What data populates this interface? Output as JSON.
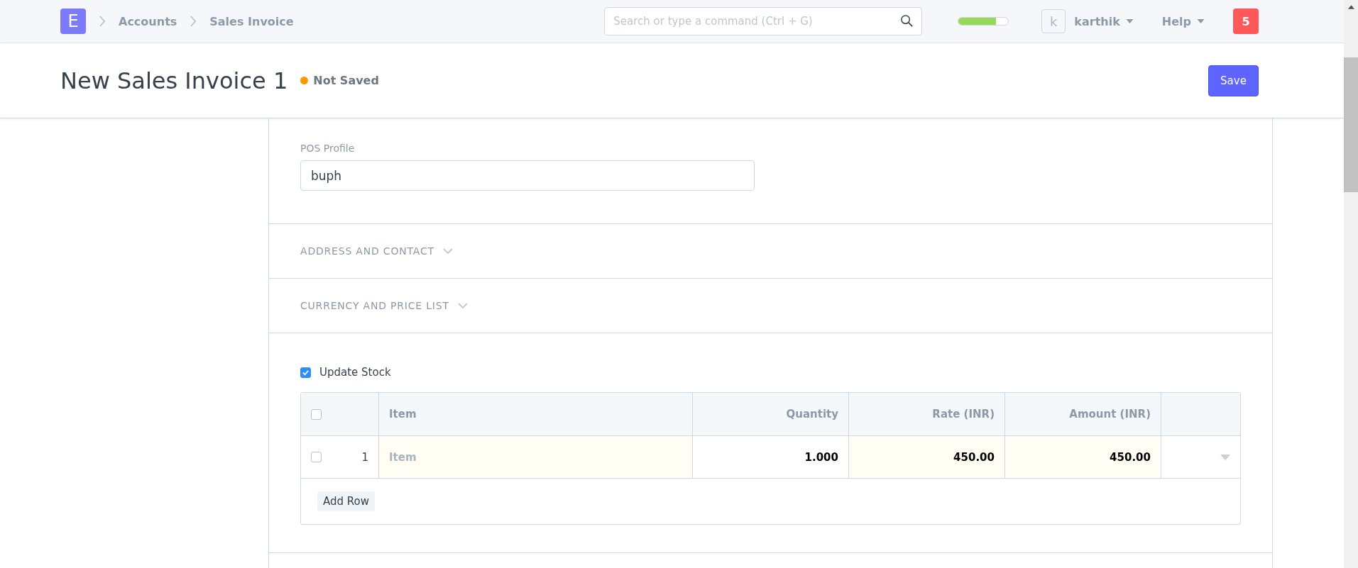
{
  "navbar": {
    "logo": "E",
    "breadcrumbs": [
      "Accounts",
      "Sales Invoice"
    ],
    "search": {
      "placeholder": "Search or type a command (Ctrl + G)"
    },
    "progress": {
      "level": 0.75
    },
    "user": {
      "avatar": "k",
      "name": "karthik"
    },
    "help": "Help",
    "notifications": "5"
  },
  "page_header": {
    "title": "New Sales Invoice 1",
    "status": "Not Saved",
    "save": "Save"
  },
  "sections": [
    {
      "kind": "fields",
      "fields": [
        {
          "label": "POS Profile",
          "value": "buph"
        }
      ]
    },
    {
      "kind": "collapsed",
      "title": "ADDRESS AND CONTACT"
    },
    {
      "kind": "collapsed",
      "title": "CURRENCY AND PRICE LIST"
    },
    {
      "kind": "items",
      "checkbox": {
        "label": "Update Stock",
        "checked": true
      },
      "table": {
        "all_selected": false,
        "columns": [
          "Item",
          "Quantity",
          "Rate (INR)",
          "Amount (INR)"
        ],
        "rows": [
          {
            "selected": false,
            "index": "1",
            "item": {
              "placeholder": "Item"
            },
            "quantity": "1.000",
            "rate": "450.00",
            "amount": "450.00"
          }
        ],
        "add_row": "Add Row"
      }
    }
  ]
}
